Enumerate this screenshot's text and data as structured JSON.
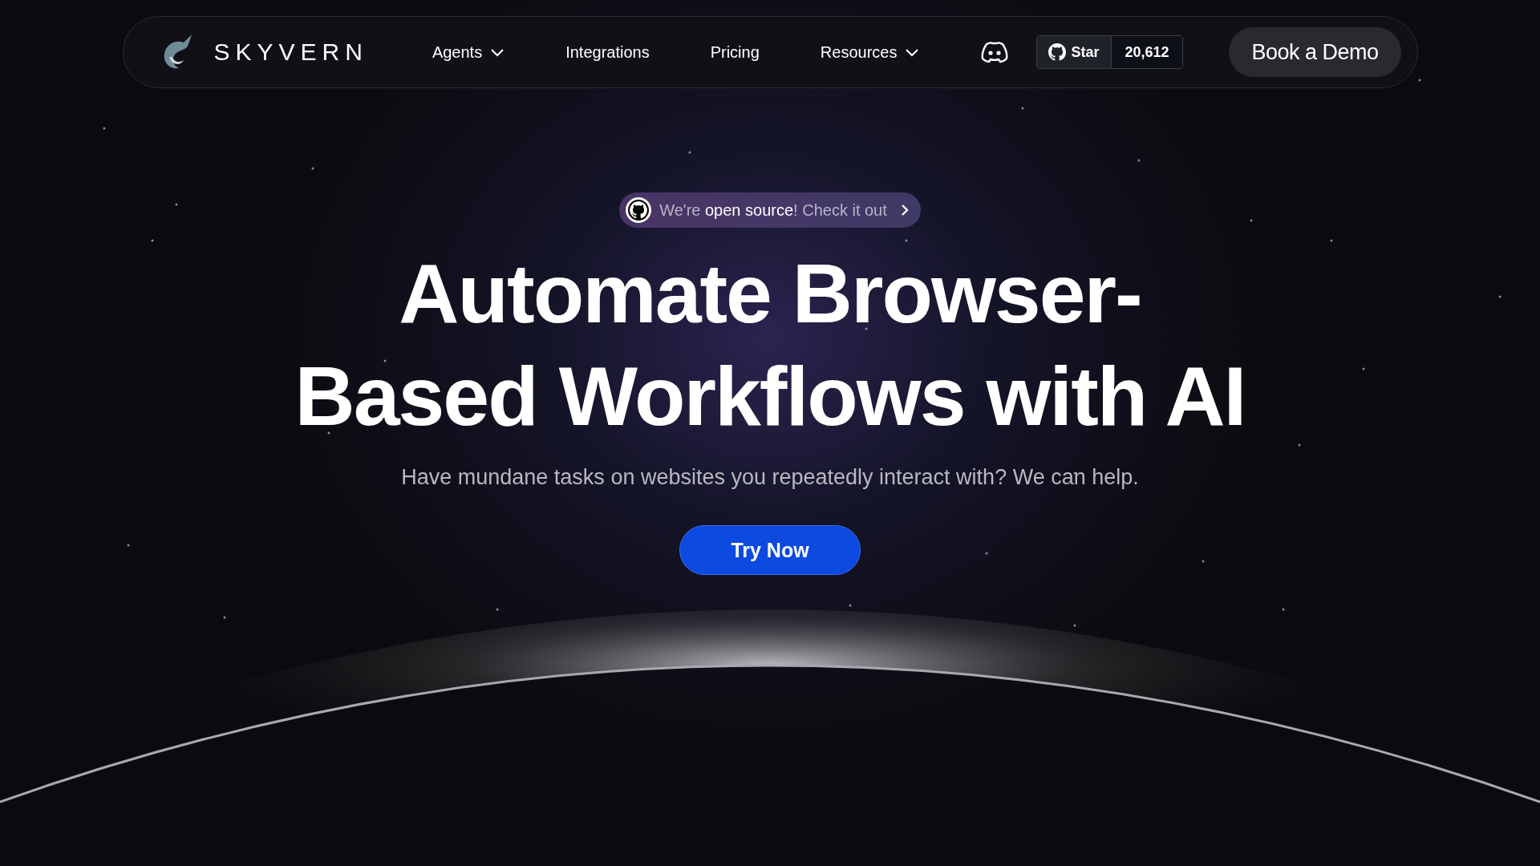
{
  "nav": {
    "brand": "SKYVERN",
    "links": [
      {
        "label": "Agents",
        "kind": "dropdown"
      },
      {
        "label": "Integrations",
        "kind": "link"
      },
      {
        "label": "Pricing",
        "kind": "link"
      },
      {
        "label": "Resources",
        "kind": "dropdown"
      }
    ],
    "github": {
      "label": "Star",
      "count": "20,612"
    },
    "cta": "Book a Demo"
  },
  "hero": {
    "badge": "We're **open source**! Check it out",
    "headline": "Automate Browser-Based Workflows with AI",
    "subtitle": "Have mundane tasks on websites you repeatedly interact with? We can help.",
    "button": "Try Now"
  }
}
